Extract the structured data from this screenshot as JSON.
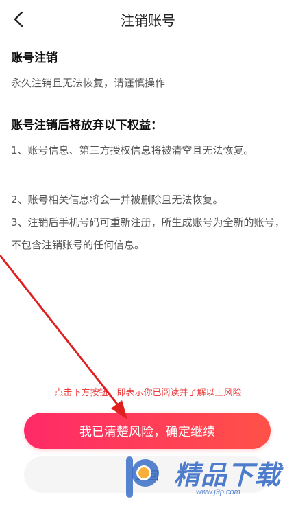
{
  "header": {
    "title": "注销账号",
    "back_icon": "chevron-left-icon"
  },
  "section1": {
    "title": "账号注销",
    "description": "永久注销且无法恢复，请谨慎操作"
  },
  "section2": {
    "title": "账号注销后将放弃以下权益：",
    "items": [
      "1、账号信息、第三方授权信息将被清空且无法恢复。",
      "2、账号相关信息将会一并被删除且无法恢复。",
      "3、注销后手机号码可重新注册，所生成账号为全新的账号，不包含注销账号的任何信息。"
    ]
  },
  "notice": "点击下方按钮，即表示你已阅读并了解以上风险",
  "buttons": {
    "confirm": "我已清楚风险，确定继续",
    "back": "返回"
  },
  "watermark": {
    "brand": "精品下载",
    "url": "www.j9p.com"
  },
  "colors": {
    "accent_start": "#ff2a68",
    "accent_end": "#ff5148",
    "notice": "#ec3c3c",
    "watermark": "#3a6fc7"
  }
}
